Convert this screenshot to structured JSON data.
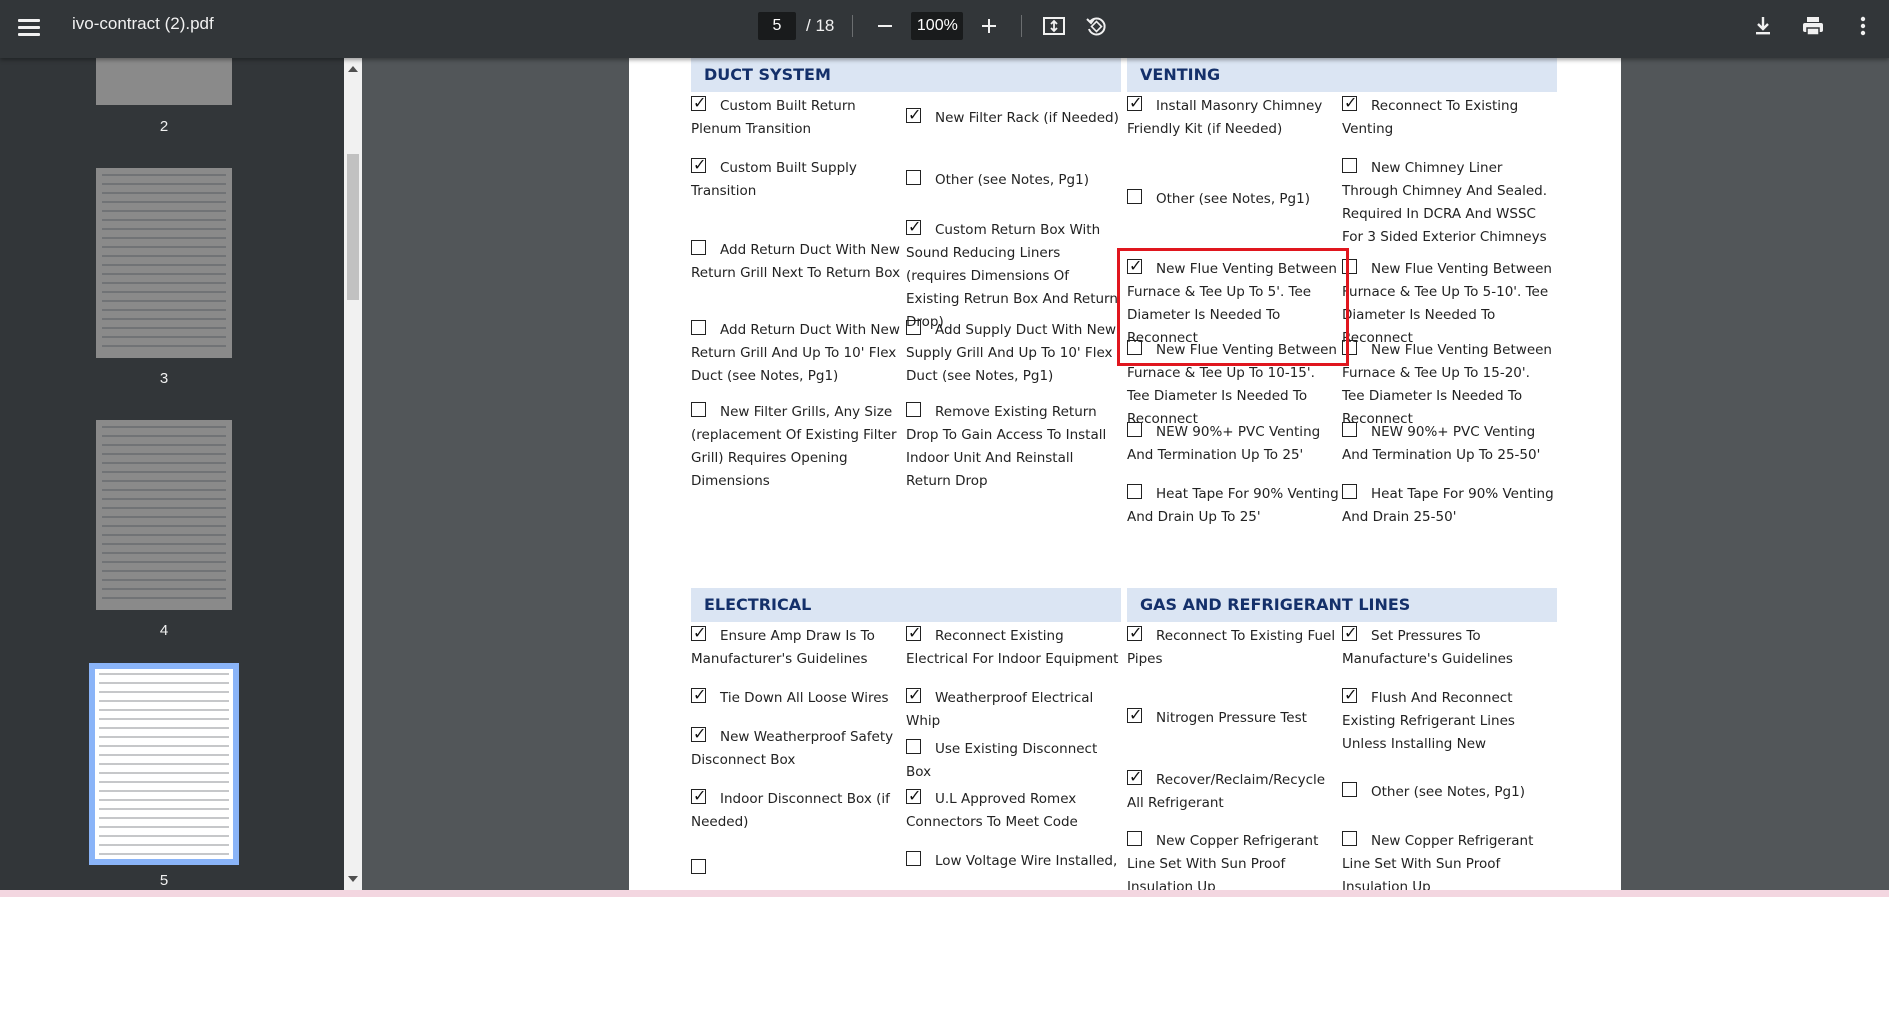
{
  "toolbar": {
    "title": "ivo-contract (2).pdf",
    "page_current": "5",
    "page_total": "/ 18",
    "zoom": "100%"
  },
  "sidebar": {
    "thumbs": [
      {
        "label": "2"
      },
      {
        "label": "3"
      },
      {
        "label": "4"
      },
      {
        "label": "5"
      }
    ]
  },
  "sections": {
    "duct": {
      "title": "DUCT SYSTEM",
      "items": [
        {
          "text": "Custom Built Return Plenum Transition",
          "checked": true
        },
        {
          "text": "New Filter Rack (if Needed)",
          "checked": true
        },
        {
          "text": "Custom Built Supply Transition",
          "checked": true
        },
        {
          "text": "Other (see Notes, Pg1)",
          "checked": false
        },
        {
          "text": "Custom Return Box With Sound Reducing Liners (requires Dimensions Of Existing Retrun Box And Return Drop)",
          "checked": true
        },
        {
          "text": "Add Return Duct With New Return Grill Next To Return Box",
          "checked": false
        },
        {
          "text": "Add Return Duct With New Return Grill And Up To 10' Flex Duct (see Notes, Pg1)",
          "checked": false
        },
        {
          "text": "Add Supply Duct With New Supply Grill And Up To 10' Flex Duct (see Notes, Pg1)",
          "checked": false
        },
        {
          "text": "New Filter Grills, Any Size (replacement Of Existing Filter Grill) Requires Opening Dimensions",
          "checked": false
        },
        {
          "text": "Remove Existing Return Drop To Gain Access To Install Indoor Unit And Reinstall Return Drop",
          "checked": false
        }
      ]
    },
    "venting": {
      "title": "VENTING",
      "items": [
        {
          "text": "Install Masonry Chimney Friendly Kit (if Needed)",
          "checked": true
        },
        {
          "text": "Reconnect To Existing Venting",
          "checked": true
        },
        {
          "text": "New Chimney Liner Through Chimney And Sealed. Required In DCRA And WSSC For 3 Sided Exterior Chimneys",
          "checked": false
        },
        {
          "text": "Other (see Notes, Pg1)",
          "checked": false
        },
        {
          "text": "New Flue Venting Between Furnace & Tee Up To 5'. Tee Diameter Is Needed To Reconnect",
          "checked": true
        },
        {
          "text": "New Flue Venting Between Furnace & Tee Up To 5-10'. Tee Diameter Is Needed To Reconnect",
          "checked": false
        },
        {
          "text": "New Flue Venting Between Furnace & Tee Up To 10-15'. Tee Diameter Is Needed To Reconnect",
          "checked": false
        },
        {
          "text": "New Flue Venting Between Furnace & Tee Up To 15-20'. Tee Diameter Is Needed To Reconnect",
          "checked": false
        },
        {
          "text": "NEW 90%+ PVC Venting And Termination Up To 25'",
          "checked": false
        },
        {
          "text": "NEW 90%+ PVC Venting And Termination Up To 25-50'",
          "checked": false
        },
        {
          "text": "Heat Tape For 90% Venting And Drain Up To 25'",
          "checked": false
        },
        {
          "text": "Heat Tape For 90% Venting And Drain 25-50'",
          "checked": false
        }
      ]
    },
    "electrical": {
      "title": "ELECTRICAL",
      "items": [
        {
          "text": "Ensure Amp Draw Is To Manufacturer's Guidelines",
          "checked": true
        },
        {
          "text": "Reconnect Existing Electrical For Indoor Equipment",
          "checked": true
        },
        {
          "text": "Tie Down All Loose Wires",
          "checked": true
        },
        {
          "text": "Weatherproof Electrical Whip",
          "checked": true
        },
        {
          "text": "New Weatherproof Safety Disconnect Box",
          "checked": true
        },
        {
          "text": "Use Existing Disconnect Box",
          "checked": false
        },
        {
          "text": "Indoor Disconnect Box (if Needed)",
          "checked": true
        },
        {
          "text": "U.L Approved Romex Connectors To Meet Code",
          "checked": true
        },
        {
          "text": "",
          "checked": false
        },
        {
          "text": "Low Voltage Wire Installed,",
          "checked": false
        }
      ]
    },
    "gas": {
      "title": "GAS AND REFRIGERANT LINES",
      "items": [
        {
          "text": "Reconnect To Existing Fuel Pipes",
          "checked": true
        },
        {
          "text": "Set Pressures To Manufacture's Guidelines",
          "checked": true
        },
        {
          "text": "Flush And Reconnect Existing Refrigerant Lines Unless Installing New",
          "checked": true
        },
        {
          "text": "Nitrogen Pressure Test",
          "checked": true
        },
        {
          "text": "Recover/Reclaim/Recycle All Refrigerant",
          "checked": true
        },
        {
          "text": "Other (see Notes, Pg1)",
          "checked": false
        },
        {
          "text": "New Copper Refrigerant Line Set With Sun Proof Insulation Up",
          "checked": false
        },
        {
          "text": "New Copper Refrigerant Line Set With Sun Proof Insulation Up",
          "checked": false
        }
      ]
    }
  }
}
